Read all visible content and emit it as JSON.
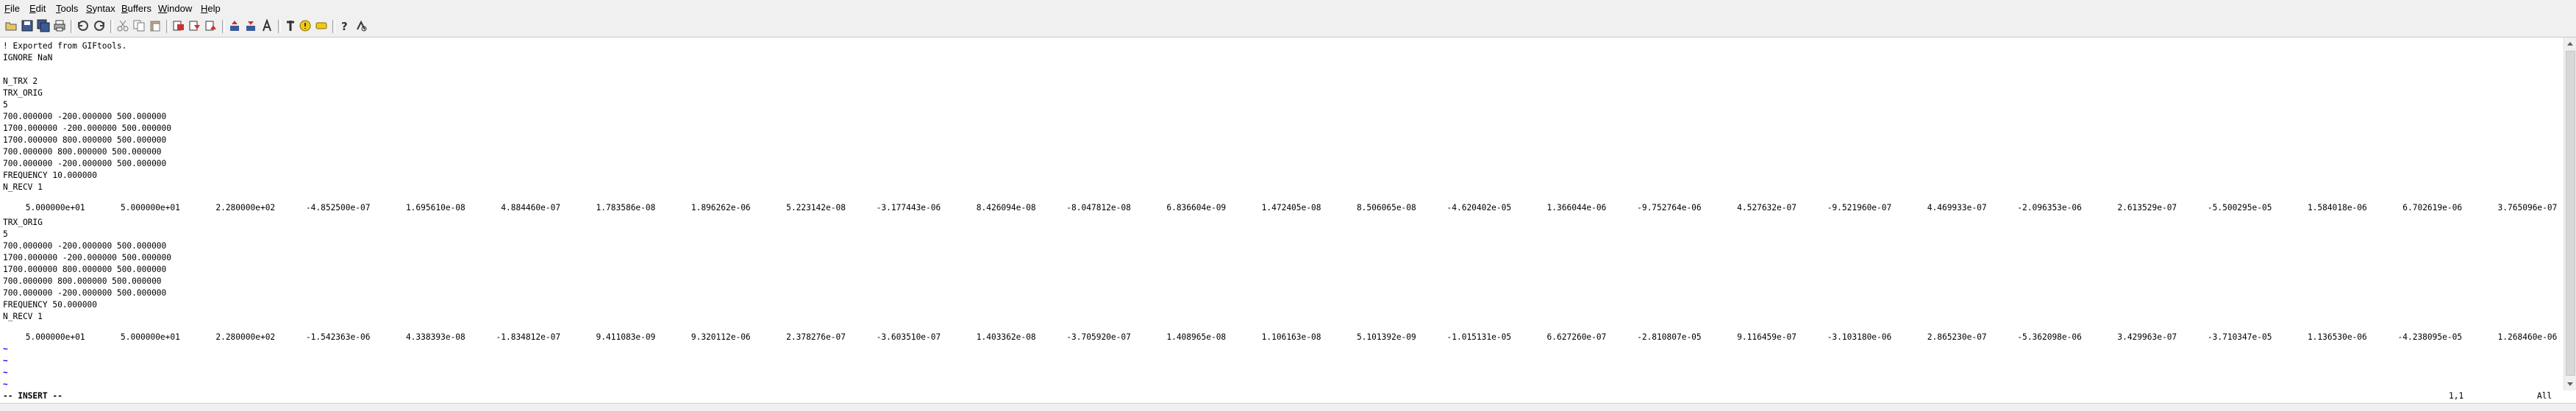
{
  "menu": [
    "File",
    "Edit",
    "Tools",
    "Syntax",
    "Buffers",
    "Window",
    "Help"
  ],
  "menu_mnemonics": [
    "F",
    "E",
    "T",
    "S",
    "B",
    "W",
    "H"
  ],
  "toolbar_icons": [
    "open-icon",
    "save-icon",
    "save-all-icon",
    "print-icon",
    "undo-icon",
    "redo-icon",
    "cut-icon",
    "copy-icon",
    "paste-icon",
    "find-replace-icon",
    "find-next-icon",
    "find-prev-icon",
    "load-session-icon",
    "save-session-icon",
    "run-script-icon",
    "make-icon",
    "ctags-icon",
    "jump-tag-icon",
    "help-icon",
    "find-help-icon"
  ],
  "lines": [
    "! Exported from GIFtools.",
    "IGNORE NaN",
    "",
    "N_TRX 2",
    "TRX_ORIG",
    "5",
    "700.000000 -200.000000 500.000000",
    "1700.000000 -200.000000 500.000000",
    "1700.000000 800.000000 500.000000",
    "700.000000 800.000000 500.000000",
    "700.000000 -200.000000 500.000000",
    "FREQUENCY 10.000000",
    "N_RECV 1",
    "",
    "",
    "TRX_ORIG",
    "5",
    "700.000000 -200.000000 500.000000",
    "1700.000000 -200.000000 500.000000",
    "1700.000000 800.000000 500.000000",
    "700.000000 800.000000 500.000000",
    "700.000000 -200.000000 500.000000",
    "FREQUENCY 50.000000",
    "N_RECV 1",
    "",
    ""
  ],
  "recv_row_1": [
    "5.000000e+01",
    "5.000000e+01",
    "2.280000e+02",
    "-4.852500e-07",
    "1.695610e-08",
    "4.884460e-07",
    "1.783586e-08",
    "1.896262e-06",
    "5.223142e-08",
    "-3.177443e-06",
    "8.426094e-08",
    "-8.047812e-08",
    "6.836604e-09",
    "1.472405e-08",
    "8.506065e-08",
    "-4.620402e-05",
    "1.366044e-06",
    "-9.752764e-06",
    "4.527632e-07",
    "-9.521960e-07",
    "4.469933e-07",
    "-2.096353e-06",
    "2.613529e-07",
    "-5.500295e-05",
    "1.584018e-06",
    "6.702619e-06",
    "3.765096e-07"
  ],
  "recv_row_2": [
    "5.000000e+01",
    "5.000000e+01",
    "2.280000e+02",
    "-1.542363e-06",
    "4.338393e-08",
    "-1.834812e-07",
    "9.411083e-09",
    "9.320112e-06",
    "2.378276e-07",
    "-3.603510e-07",
    "1.403362e-08",
    "-3.705920e-07",
    "1.408965e-08",
    "1.106163e-08",
    "5.101392e-09",
    "-1.015131e-05",
    "6.627260e-07",
    "-2.810807e-05",
    "9.116459e-07",
    "-3.103180e-06",
    "2.865230e-07",
    "-5.362098e-06",
    "3.429963e-07",
    "-3.710347e-05",
    "1.136530e-06",
    "-4.238095e-05",
    "1.268460e-06"
  ],
  "tilde_rows": [
    "~",
    "~",
    "~",
    "~",
    "~"
  ],
  "status": {
    "mode": "-- INSERT --",
    "position": "1,1",
    "percent": "All"
  }
}
